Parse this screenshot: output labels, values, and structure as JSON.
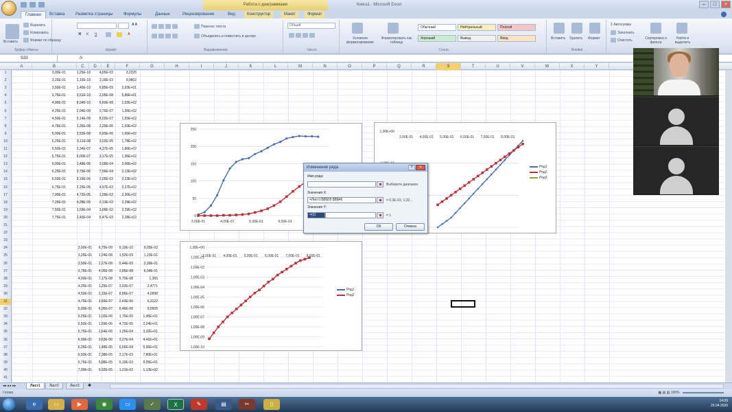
{
  "window": {
    "title": "Книга1 - Microsoft Excel",
    "context_title": "Работа с диаграммами"
  },
  "tabs": [
    "Главная",
    "Вставка",
    "Разметка страницы",
    "Формулы",
    "Данные",
    "Рецензирование",
    "Вид",
    "Конструктор",
    "Макет",
    "Формат"
  ],
  "ribbon": {
    "clipboard": {
      "label": "Буфер обмена",
      "paste": "Вставить",
      "cut": "Вырезать",
      "copy": "Копировать",
      "format_painter": "Формат по образцу"
    },
    "font": {
      "label": "Шрифт"
    },
    "alignment": {
      "label": "Выравнивание",
      "wrap": "Перенос текста",
      "merge": "Объединить и поместить в центре"
    },
    "number": {
      "label": "Число",
      "format": "Общий"
    },
    "styles": {
      "label": "Стили",
      "conditional": "Условное форматирование",
      "as_table": "Форматировать как таблицу",
      "normal": "Обычный",
      "neutral": "Нейтральный",
      "bad": "Плохой",
      "good": "Хороший",
      "check": "Вывод",
      "input": "Ввод"
    },
    "cells": {
      "label": "Ячейки",
      "insert": "Вставить",
      "delete": "Удалить",
      "format": "Формат"
    },
    "editing": {
      "label": "Правка",
      "autosum": "Автосумма",
      "fill": "Заполнить",
      "clear": "Очистить",
      "sort": "Сортировка и фильтр",
      "find": "Найти и выделить"
    }
  },
  "formula_bar": {
    "name_box": "S33",
    "fx": "fx",
    "value": ""
  },
  "columns": [
    "A",
    "B",
    "C",
    "D",
    "E",
    "F",
    "G",
    "H",
    "I",
    "J",
    "K",
    "L",
    "M",
    "N",
    "O",
    "P",
    "Q",
    "R",
    "S",
    "T",
    "U",
    "V",
    "W",
    "X",
    "Y"
  ],
  "selected_column": "S",
  "rows": [
    "1",
    "2",
    "3",
    "4",
    "5",
    "6",
    "7",
    "8",
    "9",
    "10",
    "11",
    "12",
    "13",
    "14",
    "15",
    "16",
    "17",
    "18",
    "19",
    "20",
    "21",
    "22",
    "23",
    "24",
    "25",
    "26",
    "27",
    "28",
    "29",
    "30",
    "31",
    "32",
    "33",
    "34",
    "35",
    "36",
    "37",
    "38",
    "39",
    "40",
    "41"
  ],
  "selected_row": "31",
  "table1": [
    [
      "3,00E-01",
      "1,25E-10",
      "4,65E-03",
      "3,2225"
    ],
    [
      "3,25E-01",
      "1,10E-10",
      "3,18E-03",
      "9,9802"
    ],
    [
      "3,50E-01",
      "1,40E-10",
      "6,85E-09",
      "2,93E+01"
    ],
    [
      "3,75E-01",
      "3,51E-10",
      "2,05E-08",
      "5,86E+01"
    ],
    [
      "4,00E-01",
      "8,34E-10",
      "6,60E-08",
      "1,02E+02"
    ],
    [
      "4,25E-01",
      "2,04E-09",
      "2,76E-07",
      "1,36E+02"
    ],
    [
      "4,50E-01",
      "5,14E-09",
      "8,02E-07",
      "1,55E+02"
    ],
    [
      "4,75E-01",
      "1,35E-08",
      "2,25E-06",
      "1,63E+02"
    ],
    [
      "5,00E-01",
      "3,52E-08",
      "5,93E-06",
      "1,66E+02"
    ],
    [
      "5,25E-01",
      "9,11E-08",
      "3,02E-05",
      "1,78E+02"
    ],
    [
      "5,50E-01",
      "2,34E-07",
      "4,37E-05",
      "1,86E+02"
    ],
    [
      "5,75E-01",
      "6,00E-07",
      "3,17E-05",
      "1,96E+02"
    ],
    [
      "6,00E-01",
      "1,48E-06",
      "3,05E-04",
      "2,06E+02"
    ],
    [
      "6,25E-01",
      "3,79E-06",
      "7,56E-04",
      "2,13E+02"
    ],
    [
      "6,50E-01",
      "9,19E-06",
      "2,05E-03",
      "2,23E+02"
    ],
    [
      "6,75E-01",
      "2,15E-05",
      "4,97E-03",
      "2,27E+02"
    ],
    [
      "7,00E-01",
      "4,72E-05",
      "1,09E-02",
      "2,30E+02"
    ],
    [
      "7,25E-01",
      "9,28E-05",
      "2,13E-02",
      "2,29E+02"
    ],
    [
      "7,50E-01",
      "1,59E-04",
      "3,68E-02",
      "2,29E+02"
    ],
    [
      "7,75E-01",
      "2,40E-04",
      "5,47E-02",
      "2,28E+02"
    ]
  ],
  "table2": [
    [
      "3,00E-01",
      "6,75E-09",
      "6,10E-10",
      "9,05E-02"
    ],
    [
      "3,25E-01",
      "1,24E-08",
      "1,52E-09",
      "1,23E-01"
    ],
    [
      "3,50E-01",
      "2,27E-08",
      "5,44E-09",
      "2,39E-01"
    ],
    [
      "3,75E-01",
      "4,05E-08",
      "2,85E-08",
      "6,04E-01"
    ],
    [
      "4,00E-01",
      "7,17E-08",
      "5,70E-08",
      "1,365"
    ],
    [
      "4,25E-01",
      "1,25E-07",
      "3,03E-07",
      "2,4771"
    ],
    [
      "4,50E-01",
      "2,15E-07",
      "8,86E-07",
      "4,0998"
    ],
    [
      "4,75E-01",
      "3,65E-07",
      "2,43E-06",
      "6,3122"
    ],
    [
      "5,00E-01",
      "6,05E-07",
      "6,46E-06",
      "9,5505"
    ],
    [
      "5,25E-01",
      "1,02E-06",
      "1,76E-05",
      "1,45E+01"
    ],
    [
      "5,50E-01",
      "1,69E-06",
      "4,72E-05",
      "2,24E+01"
    ],
    [
      "5,75E-01",
      "2,64E-06",
      "1,26E-04",
      "3,32E+01"
    ],
    [
      "6,00E-01",
      "3,63E-06",
      "3,27E-04",
      "4,41E+01"
    ],
    [
      "6,25E-01",
      "1,48E-05",
      "6,56E-04",
      "5,96E+01"
    ],
    [
      "6,50E-01",
      "2,38E-05",
      "2,17E-03",
      "7,80E+01"
    ],
    [
      "6,75E-01",
      "5,88E-05",
      "5,19E-03",
      "9,05E+01"
    ],
    [
      "7,00E-01",
      "9,92E-05",
      "1,21E-02",
      "1,13E+02"
    ]
  ],
  "chart_data": [
    {
      "type": "line",
      "title": "",
      "x_ticks": [
        "3,00E-01",
        "4,00E-01",
        "5,00E-01",
        "6,00E-01",
        "7,00E-01"
      ],
      "y_ticks": [
        "250",
        "200",
        "150",
        "100",
        "50",
        "0"
      ],
      "ylim": [
        0,
        250
      ],
      "series": [
        {
          "color": "#4a6fa5",
          "values": [
            3,
            10,
            29,
            59,
            102,
            136,
            155,
            163,
            166,
            178,
            186,
            196,
            206,
            213,
            223,
            227,
            230,
            229,
            229,
            228
          ]
        },
        {
          "color": "#b8323e",
          "values": [
            0,
            0,
            0,
            0,
            1,
            1,
            2,
            3,
            5,
            9,
            14,
            20,
            29,
            40,
            55,
            70,
            84,
            97,
            108,
            117
          ]
        }
      ]
    },
    {
      "type": "line",
      "title": "",
      "log_scale": true,
      "x_ticks": [
        "3,00E-01",
        "4,00E-01",
        "5,00E-01",
        "6,00E-01",
        "7,00E-01",
        "8,00E-01"
      ],
      "y_ticks": [
        "1,00E+00",
        "1,00E-01",
        "1,00E-02",
        "1,00E-03"
      ],
      "legend": [
        "Ряд1",
        "Ряд2",
        "Ряд3"
      ],
      "series": [
        {
          "name": "Ряд1",
          "color": "#4a6fa5",
          "values": [
            -3.0,
            -2.9,
            -2.8,
            -2.7,
            -2.55,
            -2.4,
            -2.25,
            -2.1,
            -1.95,
            -1.8,
            -1.65,
            -1.5,
            -1.35,
            -1.2,
            -1.05,
            -0.9,
            -0.75,
            -0.6,
            -0.45,
            -0.3
          ]
        },
        {
          "name": "Ряд2",
          "color": "#b8323e",
          "values": [
            -2.3,
            -2.2,
            -2.1,
            -2.0,
            -1.9,
            -1.8,
            -1.7,
            -1.6,
            -1.5,
            -1.4,
            -1.3,
            -1.2,
            -1.1,
            -1.0,
            -0.9,
            -0.8,
            -0.7,
            -0.6,
            -0.5,
            -0.4
          ]
        },
        {
          "name": "Ряд3",
          "color": "#8aa83a",
          "values": []
        }
      ]
    },
    {
      "type": "line",
      "title": "",
      "log_scale": true,
      "x_ticks": [
        "3,00E-01",
        "4,00E-01",
        "5,00E-01",
        "6,00E-01",
        "7,00E-01",
        "8,00E-01"
      ],
      "y_ticks": [
        "1,00E+00",
        "1,00E-01",
        "1,00E-02",
        "1,00E-03",
        "1,00E-04",
        "1,00E-05",
        "1,00E-06",
        "1,00E-07",
        "1,00E-08",
        "1,00E-09",
        "1,00E-10"
      ],
      "legend": [
        "Ряд1",
        "Ряд2"
      ],
      "series": [
        {
          "name": "Ряд2",
          "color": "#b8323e",
          "values": [
            -9.2,
            -8.6,
            -8.0,
            -7.5,
            -7.0,
            -6.6,
            -6.2,
            -5.8,
            -5.4,
            -5.0,
            -4.6,
            -4.3,
            -3.9,
            -3.5,
            -3.2,
            -2.8,
            -2.5,
            -2.2,
            -1.9,
            -1.6,
            -1.35,
            -1.2,
            -1.05
          ]
        }
      ]
    }
  ],
  "dialog": {
    "title": "Изменение ряда",
    "name_label": "Имя ряда:",
    "name_value": "",
    "name_hint": "Выберите диапазон",
    "x_label": "Значения X:",
    "x_value": "=Лист1!$B$25:$B$46",
    "x_preview": "= 0,3E-01; 1,32...",
    "y_label": "Значения Y:",
    "y_value": "={1}",
    "y_preview": "= 1",
    "ok": "ОК",
    "cancel": "Отмена"
  },
  "sheets": [
    "Лист1",
    "Лист2",
    "Лист3"
  ],
  "status": {
    "ready": "Готово",
    "zoom": "100%"
  },
  "taskbar": {
    "clock_time": "14:09",
    "clock_date": "26.04.2020"
  },
  "colors": {
    "selection": "#f5cf6b",
    "accent": "#2b579a"
  }
}
